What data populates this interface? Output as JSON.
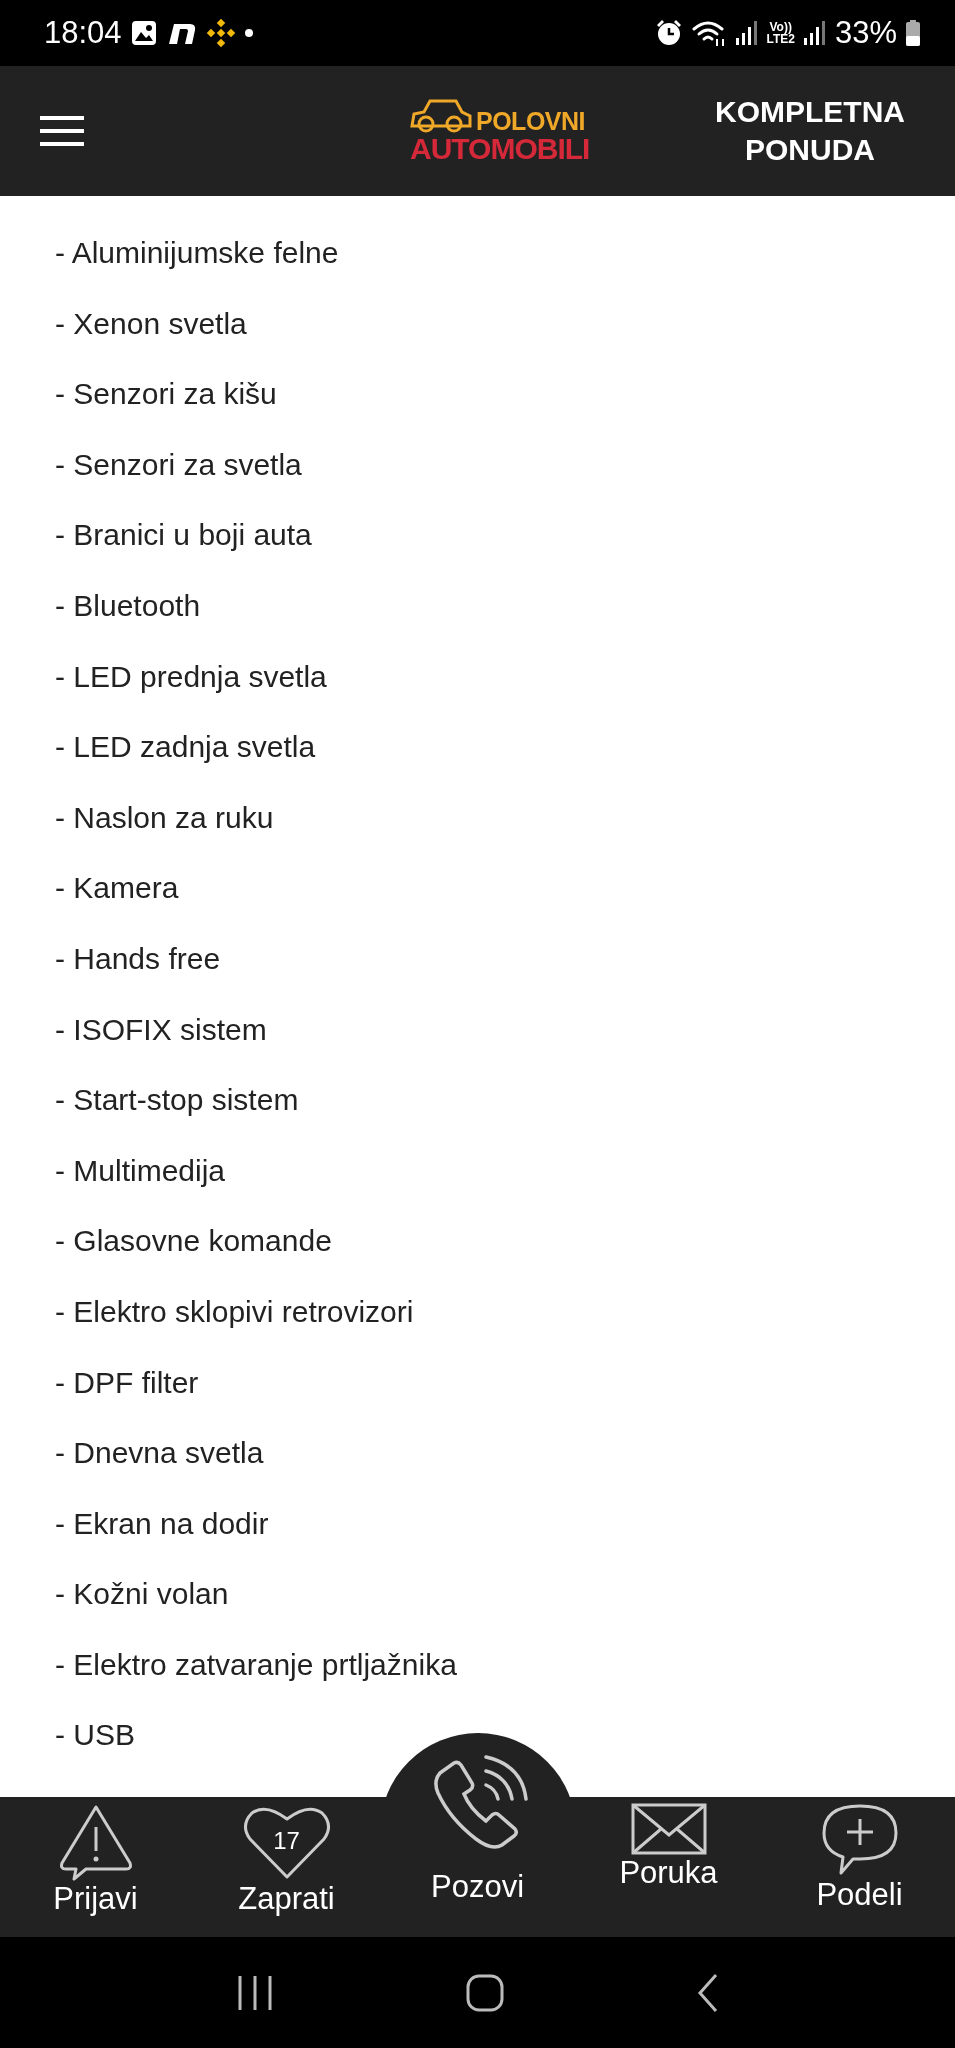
{
  "status_bar": {
    "time": "18:04",
    "network": "Vo))\nLTE2",
    "battery": "33%"
  },
  "header": {
    "logo_top": "POLOVNI",
    "logo_bottom": "AUTOMOBILI",
    "action": "KOMPLETNA PONUDA"
  },
  "features": [
    "- Aluminijumske felne",
    "- Xenon svetla",
    "- Senzori za kišu",
    "- Senzori za svetla",
    "- Branici u boji auta",
    "- Bluetooth",
    "- LED prednja svetla",
    "- LED zadnja svetla",
    "- Naslon za ruku",
    "- Kamera",
    "- Hands free",
    "- ISOFIX sistem",
    "- Start-stop sistem",
    "- Multimedija",
    "- Glasovne komande",
    "- Elektro sklopivi retrovizori",
    "- DPF filter",
    "- Dnevna svetla",
    "- Ekran na dodir",
    "- Kožni volan",
    "- Elektro zatvaranje prtljažnika",
    "- USB"
  ],
  "bottom_nav": [
    {
      "label": "Prijavi",
      "kind": "normal"
    },
    {
      "label": "Zaprati",
      "kind": "normal",
      "badge": "17"
    },
    {
      "label": "Pozovi",
      "kind": "raised"
    },
    {
      "label": "Poruka",
      "kind": "normal"
    },
    {
      "label": "Podeli",
      "kind": "normal"
    }
  ]
}
